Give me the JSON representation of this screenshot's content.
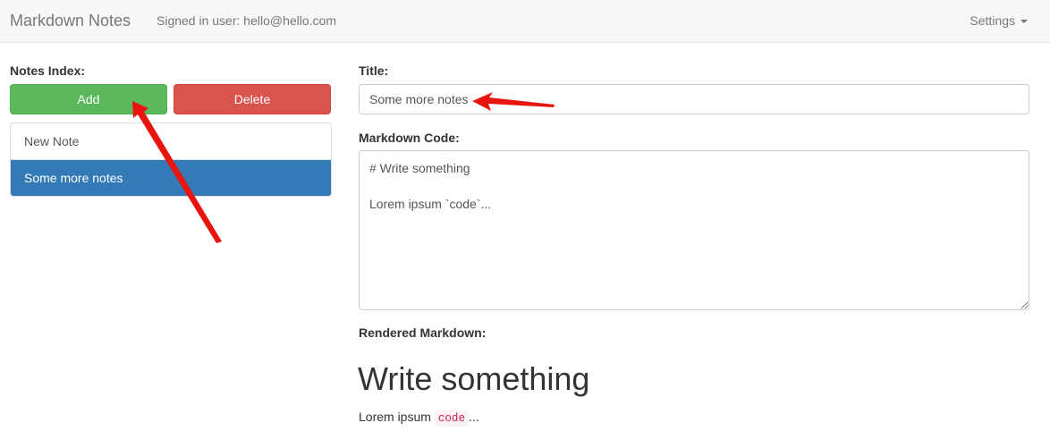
{
  "navbar": {
    "brand": "Markdown Notes",
    "signed_in": "Signed in user: hello@hello.com",
    "settings": "Settings"
  },
  "sidebar": {
    "heading": "Notes Index:",
    "add_label": "Add",
    "delete_label": "Delete",
    "notes": [
      {
        "title": "New Note",
        "active": false
      },
      {
        "title": "Some more notes",
        "active": true
      }
    ]
  },
  "editor": {
    "title_label": "Title:",
    "title_value": "Some more notes",
    "code_label": "Markdown Code:",
    "code_value": "# Write something\n\nLorem ipsum `code`...",
    "rendered_label": "Rendered Markdown:",
    "rendered_heading": "Write something",
    "rendered_text_before": "Lorem ipsum ",
    "rendered_code": "code",
    "rendered_text_after": "..."
  },
  "colors": {
    "add": "#5cb85c",
    "delete": "#d9534f",
    "active_item": "#337ab7",
    "annotation_arrow": "#e8150f"
  }
}
